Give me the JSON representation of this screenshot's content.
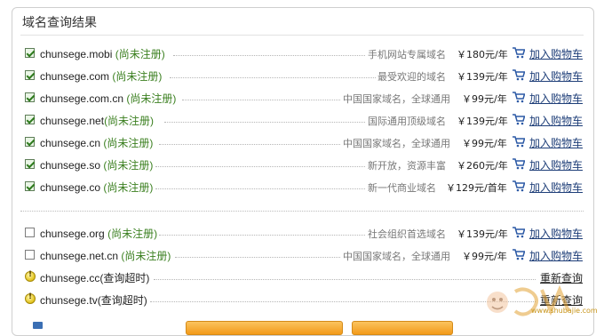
{
  "panel": {
    "title": "域名查询结果"
  },
  "registered_rows": [
    {
      "domain": "chunsege.mobi",
      "status": "(尚未注册)",
      "desc": "手机网站专属域名",
      "price": "￥180元/年",
      "action": "加入购物车",
      "checked": true
    },
    {
      "domain": "chunsege.com",
      "status": "(尚未注册)",
      "desc": "最受欢迎的域名",
      "price": "￥139元/年",
      "action": "加入购物车",
      "checked": true
    },
    {
      "domain": "chunsege.com.cn",
      "status": "(尚未注册)",
      "desc": "中国国家域名，全球通用",
      "price": "￥99元/年",
      "action": "加入购物车",
      "checked": true
    },
    {
      "domain": "chunsege.net",
      "status": "(尚未注册)",
      "desc": "国际通用顶级域名",
      "price": "￥139元/年",
      "action": "加入购物车",
      "checked": true
    },
    {
      "domain": "chunsege.cn",
      "status": "(尚未注册)",
      "desc": "中国国家域名，全球通用",
      "price": "￥99元/年",
      "action": "加入购物车",
      "checked": true
    },
    {
      "domain": "chunsege.so",
      "status": "(尚未注册)",
      "desc": "新开放，资源丰富",
      "price": "￥260元/年",
      "action": "加入购物车",
      "checked": true
    },
    {
      "domain": "chunsege.co",
      "status": "(尚未注册)",
      "desc": "新一代商业域名",
      "price": "￥129元/首年",
      "action": "加入购物车",
      "checked": true
    }
  ],
  "other_rows": [
    {
      "domain": "chunsege.org",
      "status": "(尚未注册)",
      "desc": "社会组织首选域名",
      "price": "￥139元/年",
      "action": "加入购物车",
      "checked": false
    },
    {
      "domain": "chunsege.net.cn",
      "status": "(尚未注册)",
      "desc": "中国国家域名，全球通用",
      "price": "￥99元/年",
      "action": "加入购物车",
      "checked": false
    }
  ],
  "timeout_rows": [
    {
      "domain": "chunsege.cc",
      "status": "(查询超时)",
      "action": "重新查询"
    },
    {
      "domain": "chunsege.tv",
      "status": "(查询超时)",
      "action": "重新查询"
    }
  ],
  "watermark": {
    "text": "www.shubajie.com"
  },
  "colors": {
    "available": "#3a7f1f",
    "link": "#1f3f79",
    "button": "#f29a1a"
  },
  "icons": {
    "cart": "shopping-cart-icon",
    "checked": "checkbox-checked-icon",
    "warning": "warning-icon"
  }
}
